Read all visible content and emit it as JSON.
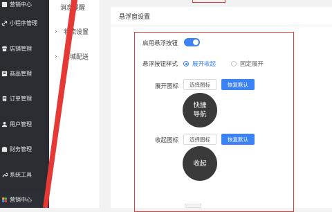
{
  "sidebar": {
    "items": [
      {
        "label": "营销中心",
        "icon": "dashboard-icon"
      },
      {
        "label": "小程序管理",
        "icon": "link-icon"
      },
      {
        "label": "店铺管理",
        "icon": "store-icon"
      },
      {
        "label": "商品管理",
        "icon": "product-icon"
      },
      {
        "label": "订单管理",
        "icon": "order-icon"
      },
      {
        "label": "用户管理",
        "icon": "user-icon"
      },
      {
        "label": "财务管理",
        "icon": "finance-icon"
      },
      {
        "label": "系统工具",
        "icon": "wrench-icon"
      },
      {
        "label": "营销中心",
        "icon": "marketing-icon"
      }
    ]
  },
  "subsidebar": {
    "items": [
      {
        "label": "消息提醒"
      },
      {
        "label": "物流设置"
      },
      {
        "label": "同城配送"
      }
    ]
  },
  "panel": {
    "title": "悬浮窗设置",
    "enable_label": "启用悬浮按钮",
    "enable_on": true,
    "style_label": "悬浮按钮样式",
    "style_options": [
      "展开收起",
      "固定展开"
    ],
    "style_selected": "展开收起",
    "expand_icon_label": "展开图标",
    "collapse_icon_label": "收起图标",
    "choose_icon_label": "选择图标",
    "restore_default_label": "恢复默认",
    "expand_bubble_lines": [
      "快捷",
      "导航"
    ],
    "collapse_bubble_text": "收起"
  },
  "colors": {
    "sidebar_bg": "#2b2d33",
    "accent": "#3b82f6",
    "annotation": "#e53935",
    "bubble": "#3a3a3a"
  }
}
